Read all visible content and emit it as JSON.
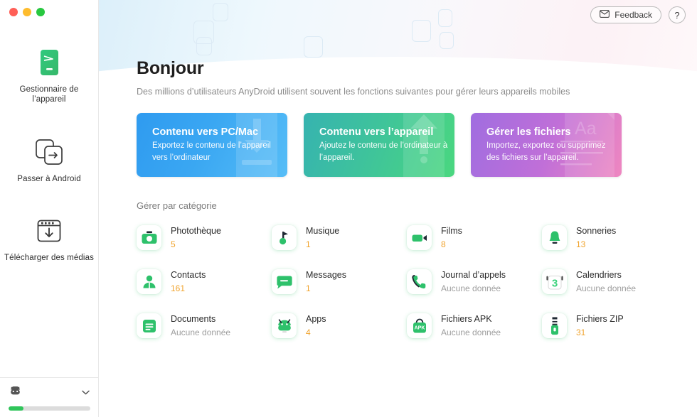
{
  "window": {
    "traffic_lights": [
      "close",
      "minimize",
      "zoom"
    ],
    "colors": {
      "close": "#ff5f57",
      "minimize": "#febc2e",
      "zoom": "#28c840",
      "accent_green": "#2fc55a",
      "count_orange": "#f0a32c"
    }
  },
  "topbar": {
    "feedback_label": "Feedback",
    "feedback_icon": "envelope-icon",
    "help_label": "?"
  },
  "sidebar": {
    "items": [
      {
        "label": "Gestionnaire de l’appareil",
        "icon": "device-phone-icon",
        "active": true
      },
      {
        "label": "Passer à Android",
        "icon": "switch-to-android-icon",
        "active": false
      },
      {
        "label": "Télécharger des médias",
        "icon": "download-media-icon",
        "active": false
      }
    ],
    "device": {
      "icon": "android-robot-icon",
      "name": "",
      "chevron": "⌄",
      "storage_percent": 18
    }
  },
  "hero": {
    "title": "Bonjour",
    "subtitle": "Des millions d’utilisateurs AnyDroid utilisent souvent les fonctions suivantes pour gérer leurs appareils mobiles"
  },
  "cards": [
    {
      "title": "Contenu vers PC/Mac",
      "desc": "Exportez le contenu de l’appareil vers l’ordinateur",
      "theme": "blue",
      "art": "download-arrow-icon",
      "color": "#3aa7f2"
    },
    {
      "title": "Contenu vers l’appareil",
      "desc": "Ajoutez le contenu de l’ordinateur à l’appareil.",
      "theme": "green",
      "art": "upload-arrow-icon",
      "color": "#3fc49a"
    },
    {
      "title": "Gérer les fichiers",
      "desc": "Importez, exportez ou supprimez des fichiers sur l’appareil.",
      "theme": "purple",
      "art": "document-aa-icon",
      "color": "#c06fd8"
    }
  ],
  "categories": {
    "heading": "Gérer par catégorie",
    "empty_text": "Aucune donnée",
    "items": [
      {
        "name": "Photothèque",
        "count": "5",
        "icon": "camera-icon",
        "empty": false
      },
      {
        "name": "Musique",
        "count": "1",
        "icon": "music-note-icon",
        "empty": false
      },
      {
        "name": "Films",
        "count": "8",
        "icon": "video-camera-icon",
        "empty": false
      },
      {
        "name": "Sonneries",
        "count": "13",
        "icon": "bell-icon",
        "empty": false
      },
      {
        "name": "Contacts",
        "count": "161",
        "icon": "contact-person-icon",
        "empty": false
      },
      {
        "name": "Messages",
        "count": "1",
        "icon": "message-bubble-icon",
        "empty": false
      },
      {
        "name": "Journal d’appels",
        "count": "Aucune donnée",
        "icon": "phone-call-icon",
        "empty": true
      },
      {
        "name": "Calendriers",
        "count": "Aucune donnée",
        "icon": "calendar-icon",
        "empty": true
      },
      {
        "name": "Documents",
        "count": "Aucune donnée",
        "icon": "document-icon",
        "empty": true
      },
      {
        "name": "Apps",
        "count": "4",
        "icon": "android-apps-icon",
        "empty": false
      },
      {
        "name": "Fichiers APK",
        "count": "Aucune donnée",
        "icon": "apk-bag-icon",
        "empty": true
      },
      {
        "name": "Fichiers ZIP",
        "count": "31",
        "icon": "zip-file-icon",
        "empty": false
      }
    ]
  }
}
